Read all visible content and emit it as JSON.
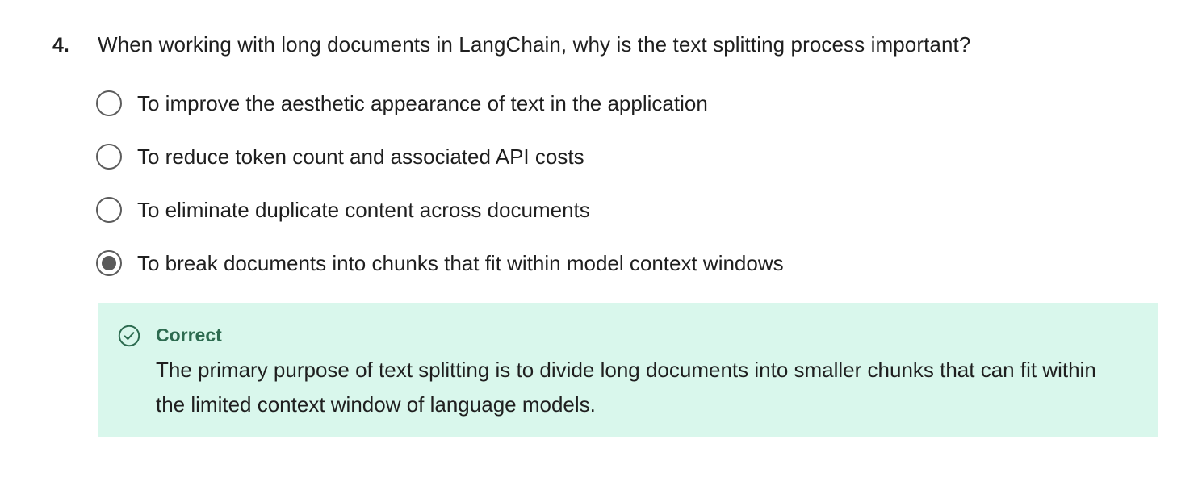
{
  "question": {
    "number": "4.",
    "text": "When working with long documents in LangChain, why is the text splitting process important?"
  },
  "options": [
    {
      "label": "To improve the aesthetic appearance of text in the application",
      "selected": false
    },
    {
      "label": "To reduce token count and associated API costs",
      "selected": false
    },
    {
      "label": "To eliminate duplicate content across documents",
      "selected": false
    },
    {
      "label": "To break documents into chunks that fit within model context windows",
      "selected": true
    }
  ],
  "feedback": {
    "status": "Correct",
    "icon": "check-circle-icon",
    "text": "The primary purpose of text splitting is to divide long documents into smaller chunks that can fit within the limited context window of language models.",
    "background_color": "#d9f7ec",
    "accent_color": "#2d6b50"
  }
}
